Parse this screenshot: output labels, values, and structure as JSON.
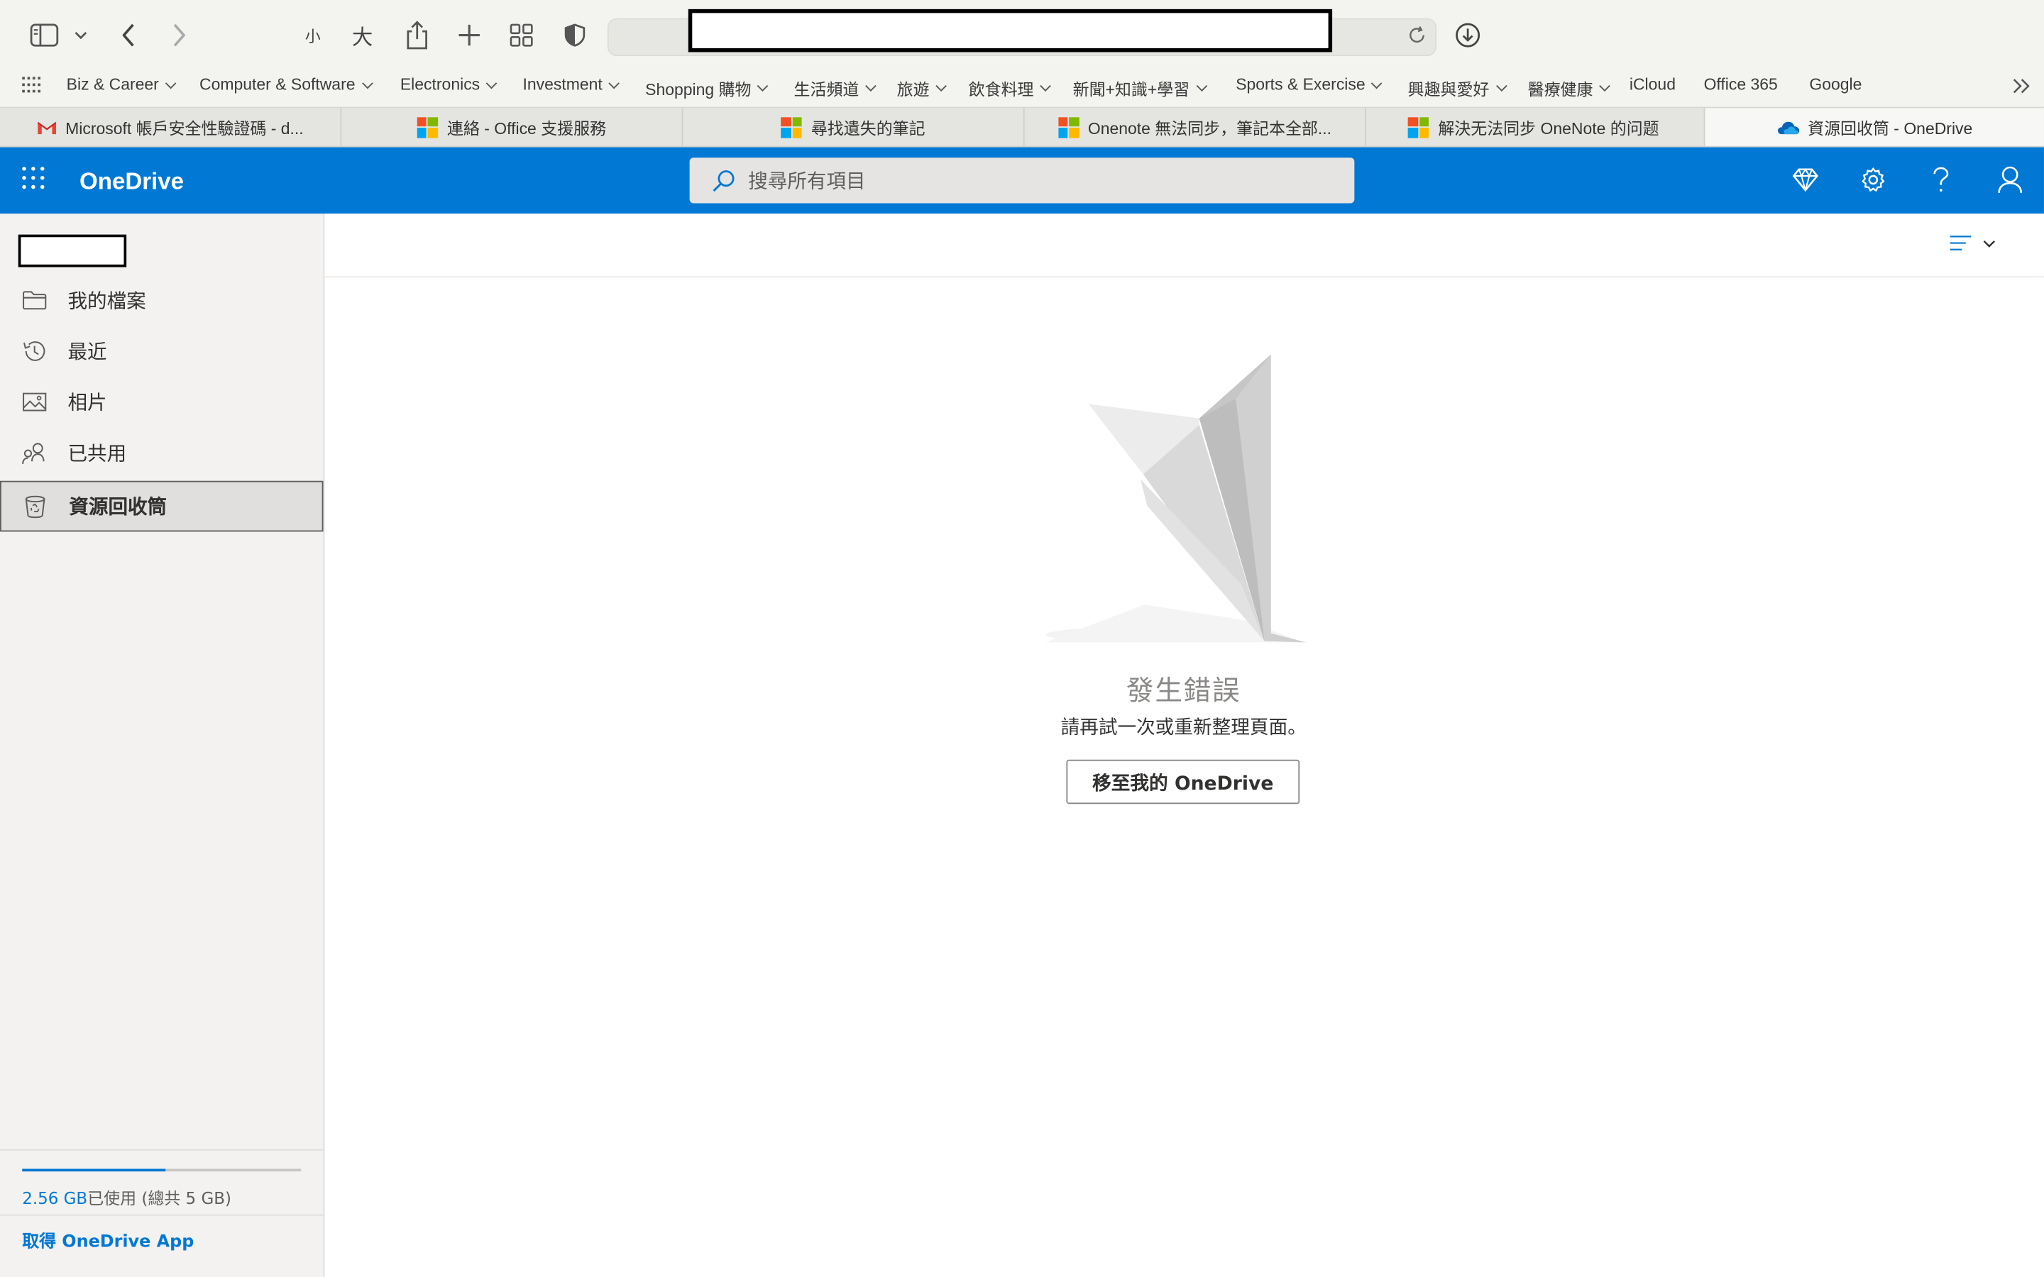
{
  "browser": {
    "font_small_label": "小",
    "font_large_label": "大"
  },
  "bookmarks": [
    {
      "label": "Biz & Career",
      "menu": true
    },
    {
      "label": "Computer & Software",
      "menu": true
    },
    {
      "label": "Electronics",
      "menu": true
    },
    {
      "label": "Investment",
      "menu": true
    },
    {
      "label": "Shopping 購物",
      "menu": true
    },
    {
      "label": "生活頻道",
      "menu": true
    },
    {
      "label": "旅遊",
      "menu": true
    },
    {
      "label": "飲食料理",
      "menu": true
    },
    {
      "label": "新聞+知識+學習",
      "menu": true
    },
    {
      "label": "Sports & Exercise",
      "menu": true
    },
    {
      "label": "興趣與愛好",
      "menu": true
    },
    {
      "label": "醫療健康",
      "menu": true
    },
    {
      "label": "iCloud",
      "menu": false
    },
    {
      "label": "Office 365",
      "menu": false
    },
    {
      "label": "Google",
      "menu": false
    }
  ],
  "tabs": [
    {
      "label": "Microsoft 帳戶安全性驗證碼 - d...",
      "icon": "gmail-icon"
    },
    {
      "label": "連絡 - Office 支援服務",
      "icon": "microsoft-logo-icon"
    },
    {
      "label": "尋找遺失的筆記",
      "icon": "microsoft-logo-icon"
    },
    {
      "label": "Onenote 無法同步，筆記本全部...",
      "icon": "microsoft-logo-icon"
    },
    {
      "label": "解決无法同步 OneNote 的问题",
      "icon": "microsoft-logo-icon"
    },
    {
      "label": "資源回收筒 - OneDrive",
      "icon": "onedrive-cloud-icon",
      "active": true
    }
  ],
  "header": {
    "brand": "OneDrive",
    "search_placeholder": "搜尋所有項目"
  },
  "sidebar": {
    "items": [
      {
        "label": "我的檔案",
        "icon": "folder-icon"
      },
      {
        "label": "最近",
        "icon": "history-icon"
      },
      {
        "label": "相片",
        "icon": "photo-icon"
      },
      {
        "label": "已共用",
        "icon": "people-icon"
      },
      {
        "label": "資源回收筒",
        "icon": "recycle-bin-icon",
        "selected": true
      }
    ],
    "storage": {
      "used": "2.56 GB",
      "used_suffix": "已使用 (總共 5 GB)",
      "fraction": 0.512
    },
    "get_app": "取得 OneDrive App"
  },
  "main": {
    "error_title": "發生錯誤",
    "error_message": "請再試一次或重新整理頁面。",
    "goto_button": "移至我的 OneDrive"
  },
  "colors": {
    "accent": "#0078d4"
  }
}
